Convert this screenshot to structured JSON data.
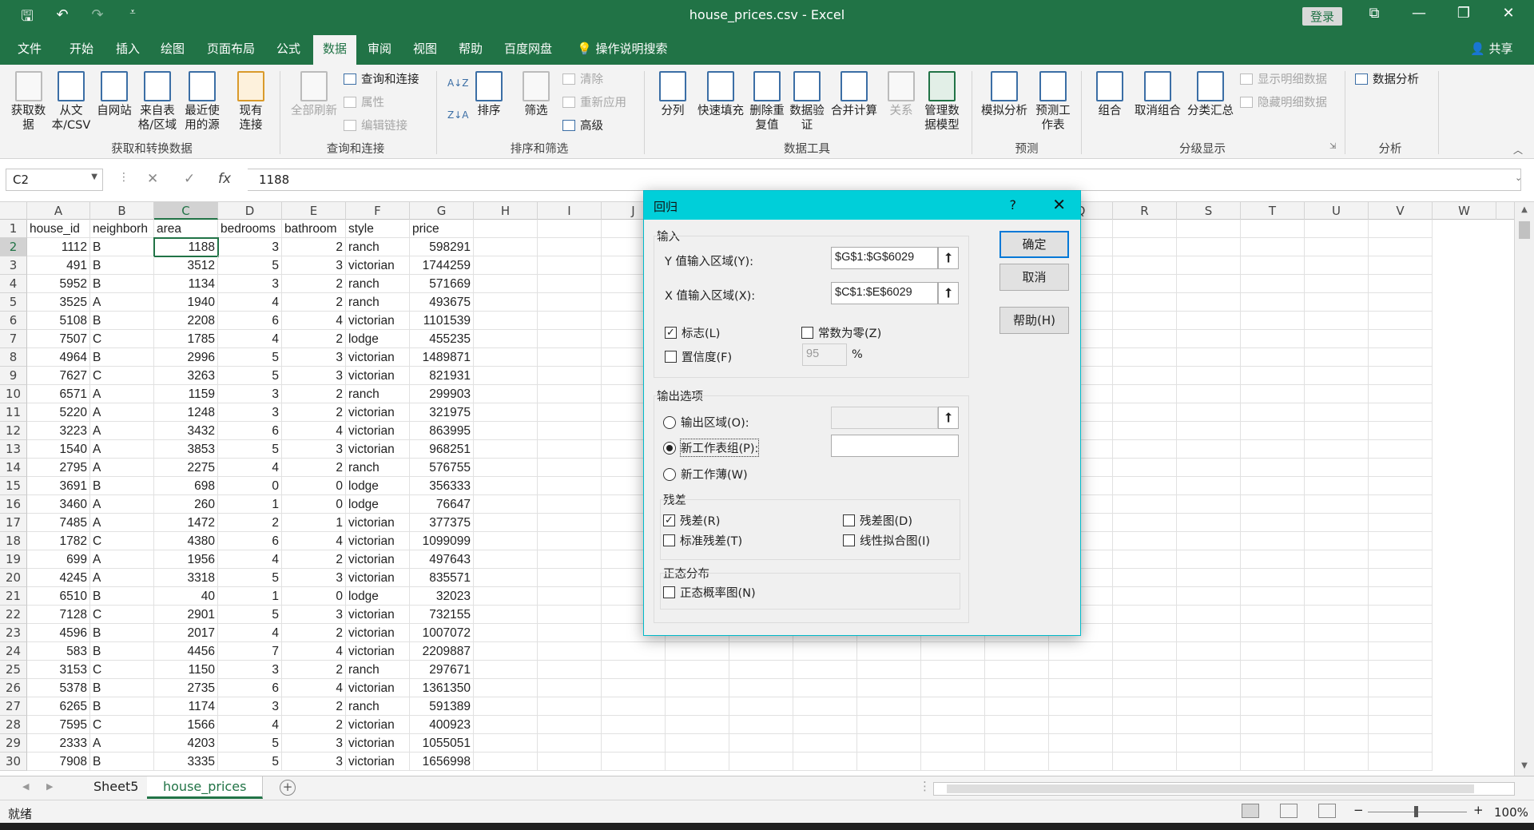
{
  "window": {
    "title": "house_prices.csv  -  Excel",
    "login": "登录",
    "qat": {
      "save": "🖫",
      "undo": "↶",
      "redo": "↷",
      "more": "⩡"
    },
    "controls": {
      "ribbon_opts": "⧉",
      "minimize": "—",
      "restore": "❐",
      "close": "✕"
    }
  },
  "menu": {
    "tabs": [
      "文件",
      "开始",
      "插入",
      "绘图",
      "页面布局",
      "公式",
      "数据",
      "审阅",
      "视图",
      "帮助",
      "百度网盘"
    ],
    "active": "数据",
    "search": "操作说明搜索",
    "share": "共享"
  },
  "ribbon": {
    "get_data": "获取数据",
    "from_csv": "从文本/CSV",
    "from_web": "自网站",
    "from_table": "来自表格/区域",
    "recent_sources": "最近使用的源",
    "existing_conn": "现有连接",
    "group_get": "获取和转换数据",
    "refresh_all": "全部刷新",
    "queries_conn": "查询和连接",
    "properties": "属性",
    "edit_links": "编辑链接",
    "group_queries": "查询和连接",
    "sort_az": "A↓Z",
    "sort_za": "Z↓A",
    "sort": "排序",
    "filter": "筛选",
    "clear": "清除",
    "reapply": "重新应用",
    "advanced": "高级",
    "group_sort": "排序和筛选",
    "text_to_cols": "分列",
    "flash_fill": "快速填充",
    "remove_dup": "删除重复值",
    "validation": "数据验证",
    "consolidate": "合并计算",
    "relationships": "关系",
    "data_model": "管理数据模型",
    "group_tools": "数据工具",
    "what_if": "模拟分析",
    "forecast_sheet": "预测工作表",
    "group_forecast": "预测",
    "group_btn": "组合",
    "ungroup": "取消组合",
    "subtotal": "分类汇总",
    "show_detail": "显示明细数据",
    "hide_detail": "隐藏明细数据",
    "group_outline": "分级显示",
    "data_analysis": "数据分析",
    "group_analysis": "分析"
  },
  "formula_bar": {
    "name_box": "C2",
    "cancel": "✕",
    "enter": "✓",
    "fx": "fx",
    "value": "1188"
  },
  "sheet": {
    "columns": [
      "A",
      "B",
      "C",
      "D",
      "E",
      "F",
      "G",
      "H",
      "I",
      "J",
      "K",
      "L",
      "M",
      "N",
      "O",
      "P",
      "Q",
      "R",
      "S",
      "T",
      "U",
      "V",
      "W"
    ],
    "selected_col": "C",
    "selected_row": 2,
    "headers": [
      "house_id",
      "neighborh",
      "area",
      "bedrooms",
      "bathroom",
      "style",
      "price"
    ],
    "rows": [
      [
        1112,
        "B",
        1188,
        3,
        2,
        "ranch",
        598291
      ],
      [
        491,
        "B",
        3512,
        5,
        3,
        "victorian",
        1744259
      ],
      [
        5952,
        "B",
        1134,
        3,
        2,
        "ranch",
        571669
      ],
      [
        3525,
        "A",
        1940,
        4,
        2,
        "ranch",
        493675
      ],
      [
        5108,
        "B",
        2208,
        6,
        4,
        "victorian",
        1101539
      ],
      [
        7507,
        "C",
        1785,
        4,
        2,
        "lodge",
        455235
      ],
      [
        4964,
        "B",
        2996,
        5,
        3,
        "victorian",
        1489871
      ],
      [
        7627,
        "C",
        3263,
        5,
        3,
        "victorian",
        821931
      ],
      [
        6571,
        "A",
        1159,
        3,
        2,
        "ranch",
        299903
      ],
      [
        5220,
        "A",
        1248,
        3,
        2,
        "victorian",
        321975
      ],
      [
        3223,
        "A",
        3432,
        6,
        4,
        "victorian",
        863995
      ],
      [
        1540,
        "A",
        3853,
        5,
        3,
        "victorian",
        968251
      ],
      [
        2795,
        "A",
        2275,
        4,
        2,
        "ranch",
        576755
      ],
      [
        3691,
        "B",
        698,
        0,
        0,
        "lodge",
        356333
      ],
      [
        3460,
        "A",
        260,
        1,
        0,
        "lodge",
        76647
      ],
      [
        7485,
        "A",
        1472,
        2,
        1,
        "victorian",
        377375
      ],
      [
        1782,
        "C",
        4380,
        6,
        4,
        "victorian",
        1099099
      ],
      [
        699,
        "A",
        1956,
        4,
        2,
        "victorian",
        497643
      ],
      [
        4245,
        "A",
        3318,
        5,
        3,
        "victorian",
        835571
      ],
      [
        6510,
        "B",
        40,
        1,
        0,
        "lodge",
        32023
      ],
      [
        7128,
        "C",
        2901,
        5,
        3,
        "victorian",
        732155
      ],
      [
        4596,
        "B",
        2017,
        4,
        2,
        "victorian",
        1007072
      ],
      [
        583,
        "B",
        4456,
        7,
        4,
        "victorian",
        2209887
      ],
      [
        3153,
        "C",
        1150,
        3,
        2,
        "ranch",
        297671
      ],
      [
        5378,
        "B",
        2735,
        6,
        4,
        "victorian",
        1361350
      ],
      [
        6265,
        "B",
        1174,
        3,
        2,
        "ranch",
        591389
      ],
      [
        7595,
        "C",
        1566,
        4,
        2,
        "victorian",
        400923
      ],
      [
        2333,
        "A",
        4203,
        5,
        3,
        "victorian",
        1055051
      ],
      [
        7908,
        "B",
        3335,
        5,
        3,
        "victorian",
        1656998
      ]
    ]
  },
  "sheet_tabs": [
    "Sheet5",
    "house_prices"
  ],
  "active_sheet": "house_prices",
  "status": {
    "ready": "就绪",
    "zoom": "100%"
  },
  "dialog": {
    "title": "回归",
    "help_icon": "?",
    "close_icon": "✕",
    "input_section": "输入",
    "y_label": "Y 值输入区域(Y):",
    "y_value": "$G$1:$G$6029",
    "x_label": "X 值输入区域(X):",
    "x_value": "$C$1:$E$6029",
    "labels_chk": "标志(L)",
    "labels_checked": true,
    "const_zero": "常数为零(Z)",
    "confidence": "置信度(F)",
    "confidence_value": "95",
    "percent": "%",
    "output_section": "输出选项",
    "output_range": "输出区域(O):",
    "new_sheet": "新工作表组(P):",
    "new_workbook": "新工作薄(W)",
    "residual_section": "残差",
    "residuals": "残差(R)",
    "residuals_checked": true,
    "residual_plots": "残差图(D)",
    "std_residuals": "标准残差(T)",
    "line_fit": "线性拟合图(I)",
    "normal_section": "正态分布",
    "normal_plot": "正态概率图(N)",
    "ok": "确定",
    "cancel": "取消",
    "help": "帮助(H)",
    "check_mark": "✓"
  }
}
